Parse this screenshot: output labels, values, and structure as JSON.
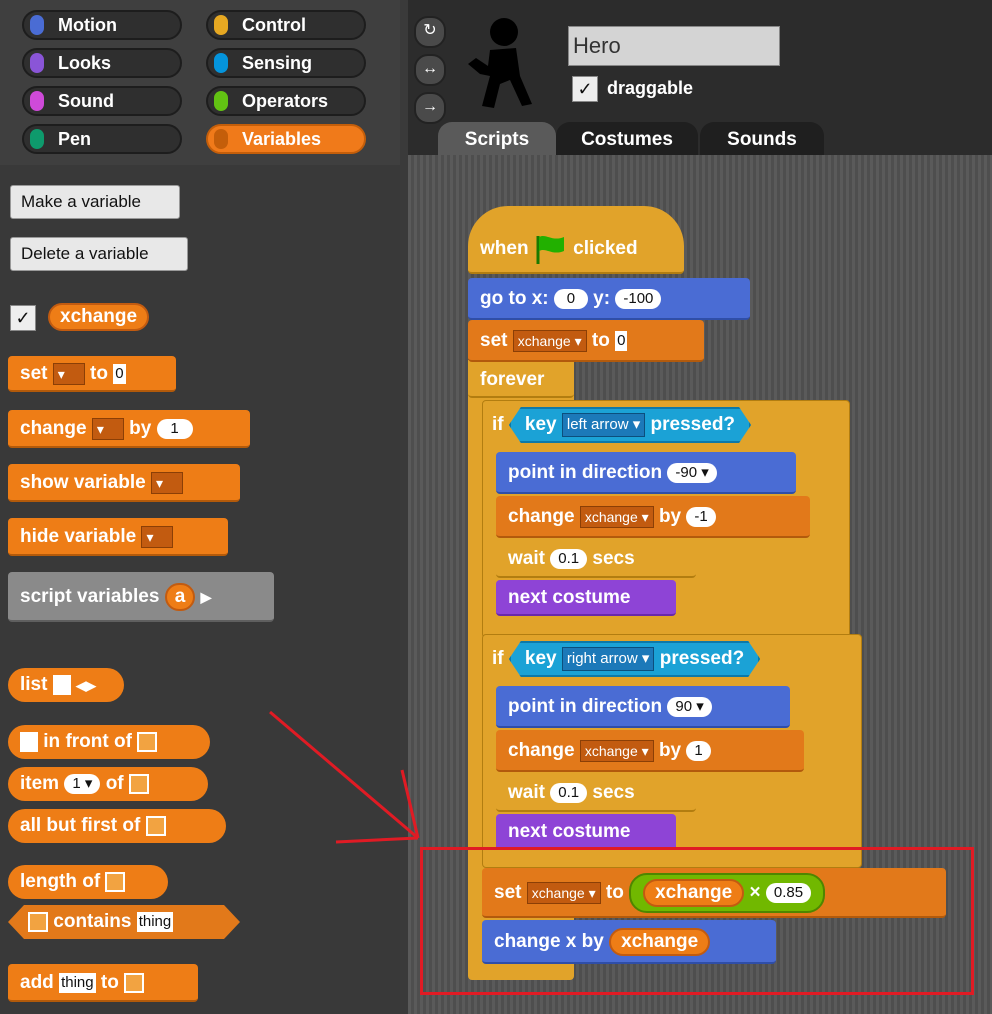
{
  "categories": [
    {
      "label": "Motion",
      "color": "#4a6cd4"
    },
    {
      "label": "Looks",
      "color": "#8a55d7"
    },
    {
      "label": "Sound",
      "color": "#cf4ad9"
    },
    {
      "label": "Pen",
      "color": "#0e9a6c"
    },
    {
      "label": "Control",
      "color": "#e6a822"
    },
    {
      "label": "Sensing",
      "color": "#0494dc"
    },
    {
      "label": "Operators",
      "color": "#62c213"
    },
    {
      "label": "Variables",
      "color": "#ee7d16",
      "active": true
    }
  ],
  "palette": {
    "make_variable": "Make a variable",
    "delete_variable": "Delete a variable",
    "var_name": "xchange",
    "set": "set",
    "to": "to",
    "set_value": "0",
    "change": "change",
    "by": "by",
    "change_value": "1",
    "show_variable": "show variable",
    "hide_variable": "hide variable",
    "script_variables": "script variables",
    "script_var": "a",
    "list": "list",
    "in_front_of": "in front of",
    "item": "item",
    "item_value": "1",
    "of": "of",
    "all_but_first_of": "all but first of",
    "length_of": "length of",
    "contains": "contains",
    "thing": "thing",
    "add": "add",
    "add_thing": "thing"
  },
  "sprite": {
    "name": "Hero",
    "draggable_label": "draggable",
    "draggable_checked": true,
    "tabs": [
      "Scripts",
      "Costumes",
      "Sounds"
    ]
  },
  "script": {
    "when": "when",
    "clicked": "clicked",
    "goto": "go to x:",
    "x": "0",
    "y_label": "y:",
    "y": "-100",
    "set": "set",
    "var": "xchange",
    "to": "to",
    "set_val": "0",
    "forever": "forever",
    "if": "if",
    "key": "key",
    "pressed": "pressed?",
    "left_arrow": "left arrow",
    "right_arrow": "right arrow",
    "point": "point in direction",
    "dir_left": "-90",
    "dir_right": "90",
    "change": "change",
    "by": "by",
    "left_change": "-1",
    "right_change": "1",
    "wait": "wait",
    "wait_val": "0.1",
    "secs": "secs",
    "next_costume": "next costume",
    "times": "×",
    "factor": "0.85",
    "change_x": "change x by"
  }
}
